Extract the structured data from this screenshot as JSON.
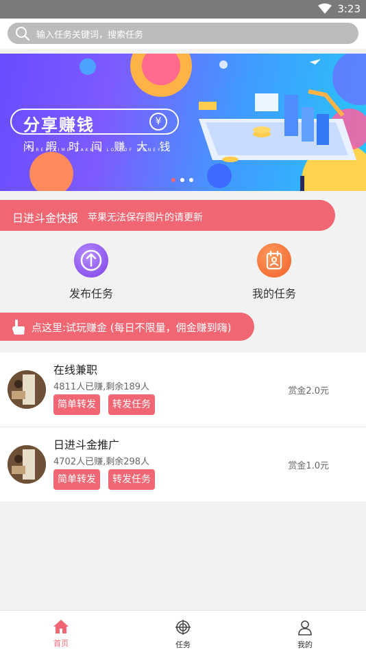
{
  "status_bar": {
    "time": "3:23"
  },
  "search": {
    "placeholder": "输入任务关键词，搜索任务"
  },
  "banner": {
    "title": "分享赚钱",
    "subtitle": "闲 暇 时 间 赚 大 钱",
    "tagline": "FREE TIME MAKE A LOT OF MONEY",
    "coin_symbol": "¥",
    "active_index": 0,
    "dot_count": 3
  },
  "news": {
    "label": "日进斗金快报",
    "text": "苹果无法保存图片的请更新"
  },
  "features": [
    {
      "label": "发布任务",
      "icon": "upload-icon"
    },
    {
      "label": "我的任务",
      "icon": "task-card-icon"
    }
  ],
  "try_play": {
    "text": "点这里:试玩赚金 (每日不限量，佣金赚到嗨)",
    "icon": "hand-pointer-icon"
  },
  "tasks": [
    {
      "title": "在线兼职",
      "meta": "4811人已赚,剩余189人",
      "btn1": "简单转发",
      "btn2": "转发任务",
      "reward": "赏金2.0元"
    },
    {
      "title": "日进斗金推广",
      "meta": "4702人已赚,剩余298人",
      "btn1": "简单转发",
      "btn2": "转发任务",
      "reward": "赏金1.0元"
    }
  ],
  "tabbar": [
    {
      "label": "首页",
      "icon": "home-icon",
      "active": true
    },
    {
      "label": "任务",
      "icon": "target-icon",
      "active": false
    },
    {
      "label": "我的",
      "icon": "user-icon",
      "active": false
    }
  ],
  "colors": {
    "accent": "#f06673",
    "tab_active": "#f06673",
    "tab_inactive": "#333333"
  }
}
